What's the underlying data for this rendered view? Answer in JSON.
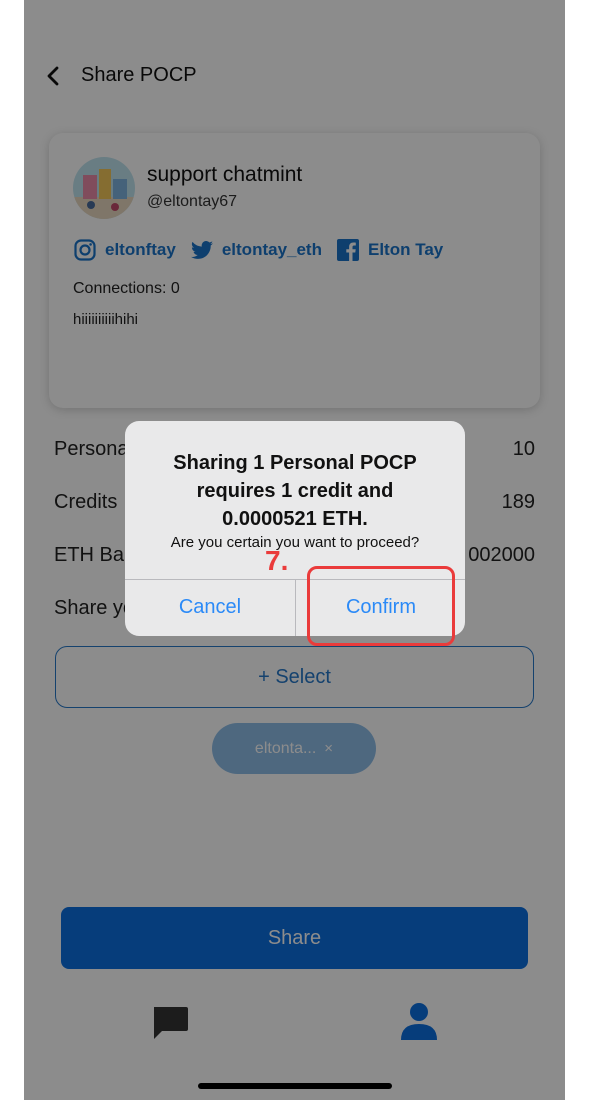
{
  "header": {
    "title": "Share POCP"
  },
  "profile": {
    "display_name": "support chatmint",
    "handle": "@eltontay67",
    "socials": [
      {
        "icon": "instagram-icon",
        "label": "eltonftay"
      },
      {
        "icon": "twitter-icon",
        "label": "eltontay_eth"
      },
      {
        "icon": "facebook-icon",
        "label": "Elton Tay"
      }
    ],
    "connections": "Connections: 0",
    "bio": "hiiiiiiiiiihihi"
  },
  "rows": [
    {
      "label": "Persona",
      "value": "10"
    },
    {
      "label": "Credits",
      "value": "189"
    },
    {
      "label": "ETH Bal",
      "value": "002000"
    },
    {
      "label": "Share yo",
      "value": ""
    }
  ],
  "select_label": "+ Select",
  "chip": {
    "label": "eltonta...",
    "close": "×"
  },
  "share_label": "Share",
  "tabbar": {
    "chat_icon": "chat-bubble-icon",
    "profile_icon": "person-icon"
  },
  "dialog": {
    "title_line1": "Sharing 1 Personal POCP",
    "title_line2": "requires 1 credit and",
    "title_line3": "0.0000521 ETH.",
    "message": "Are you certain you want to proceed?",
    "cancel_label": "Cancel",
    "confirm_label": "Confirm"
  },
  "annotation": {
    "step": "7.",
    "color": "#ea3b3b"
  },
  "colors": {
    "accent": "#0c6fe0",
    "link": "#1a73c8",
    "dialog_button": "#2b8af7"
  }
}
